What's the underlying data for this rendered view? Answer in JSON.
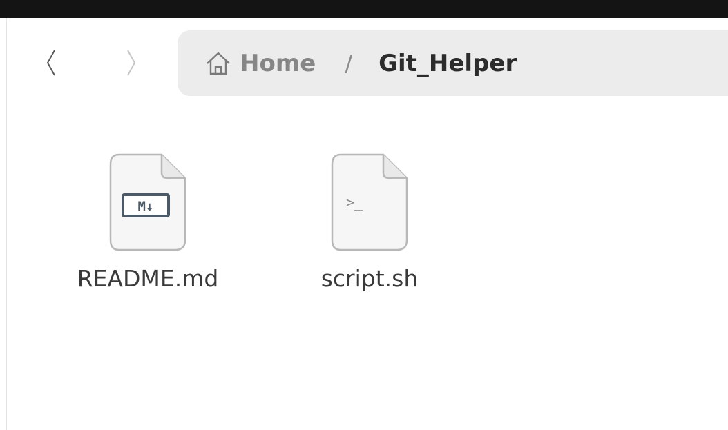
{
  "navigation": {
    "back_icon": "chevron-left-icon",
    "forward_icon": "chevron-right-icon"
  },
  "breadcrumb": {
    "home_icon": "home-icon",
    "home_label": "Home",
    "separator": "/",
    "current": "Git_Helper"
  },
  "files": [
    {
      "name": "README.md",
      "icon": "markdown-file-icon",
      "badge": "M↓"
    },
    {
      "name": "script.sh",
      "icon": "shell-script-file-icon",
      "badge": ">_"
    }
  ],
  "colors": {
    "topbar": "#141414",
    "pathbar_bg": "#ececec",
    "icon_bg": "#f6f6f6",
    "icon_border": "#b8b8b8",
    "markdown_badge": "#4b5a66"
  }
}
